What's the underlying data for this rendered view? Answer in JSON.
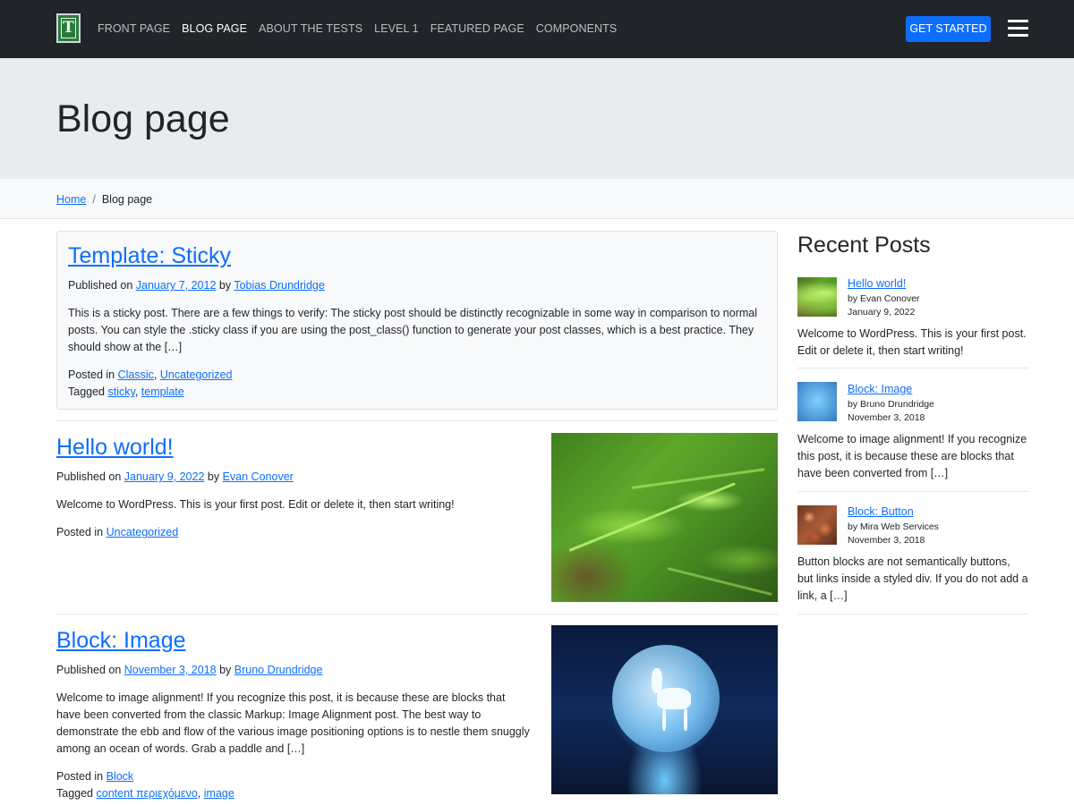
{
  "nav": {
    "links": [
      "FRONT PAGE",
      "BLOG PAGE",
      "ABOUT THE TESTS",
      "LEVEL 1",
      "FEATURED PAGE",
      "COMPONENTS"
    ],
    "active": "BLOG PAGE",
    "cta": "GET STARTED"
  },
  "hero": {
    "title": "Blog page"
  },
  "breadcrumb": {
    "home": "Home",
    "separator": "/",
    "current": "Blog page"
  },
  "posts": [
    {
      "title": "Template: Sticky",
      "published_label": "Published on",
      "date": "January 7, 2012",
      "by_label": "by",
      "author": "Tobias Drundridge",
      "excerpt": "This is a sticky post. There are a few things to verify: The sticky post should be distinctly recognizable in some way in comparison to normal posts. You can style the .sticky class if you are using the post_class() function to generate your post classes, which is a best practice. They should show at the […]",
      "posted_label": "Posted in",
      "categories": [
        "Classic",
        "Uncategorized"
      ],
      "tagged_label": "Tagged",
      "tags": [
        "sticky",
        "template"
      ]
    },
    {
      "title": "Hello world!",
      "published_label": "Published on",
      "date": "January 9, 2022",
      "by_label": "by",
      "author": "Evan Conover",
      "excerpt": "Welcome to WordPress. This is your first post. Edit or delete it, then start writing!",
      "posted_label": "Posted in",
      "categories": [
        "Uncategorized"
      ]
    },
    {
      "title": "Block: Image",
      "published_label": "Published on",
      "date": "November 3, 2018",
      "by_label": "by",
      "author": "Bruno Drundridge",
      "excerpt": "Welcome to image alignment! If you recognize this post, it is because these are blocks that have been converted from the classic Markup: Image Alignment post. The best way to demonstrate the ebb and flow of the various image positioning options is to nestle them snuggly among an ocean of words. Grab a paddle and […]",
      "posted_label": "Posted in",
      "categories": [
        "Block"
      ],
      "tagged_label": "Tagged",
      "tags": [
        "content περιεχόμενο",
        "image"
      ]
    }
  ],
  "sidebar": {
    "title": "Recent Posts",
    "items": [
      {
        "title": "Hello world!",
        "byline": "by Evan Conover",
        "date": "January 9, 2022",
        "excerpt": "Welcome to WordPress. This is your first post. Edit or delete it, then start writing!"
      },
      {
        "title": "Block: Image",
        "byline": "by Bruno Drundridge",
        "date": "November 3, 2018",
        "excerpt": "Welcome to image alignment! If you recognize this post, it is because these are blocks that have been converted from […]"
      },
      {
        "title": "Block: Button",
        "byline": "by Mira Web Services",
        "date": "November 3, 2018",
        "excerpt": "Button blocks are not semantically buttons, but links inside a styled div.  If you do not add a link, a […]"
      }
    ]
  },
  "colors": {
    "navbar": "#212529",
    "accent": "#0d6efd",
    "hero_bg": "#e9ecef",
    "breadcrumb_bg": "#f8f9fa"
  }
}
